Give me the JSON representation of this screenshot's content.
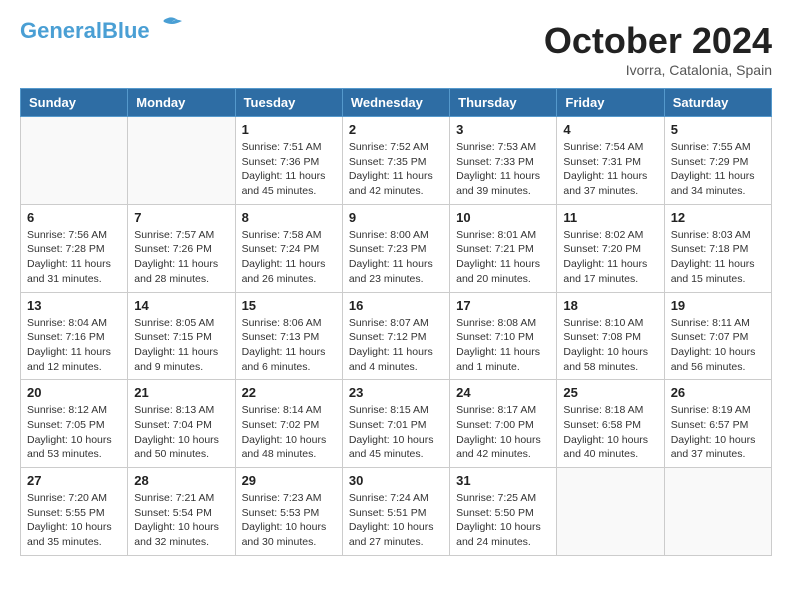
{
  "header": {
    "logo_line1": "General",
    "logo_line2": "Blue",
    "month": "October 2024",
    "location": "Ivorra, Catalonia, Spain"
  },
  "weekdays": [
    "Sunday",
    "Monday",
    "Tuesday",
    "Wednesday",
    "Thursday",
    "Friday",
    "Saturday"
  ],
  "weeks": [
    [
      {
        "day": "",
        "sunrise": "",
        "sunset": "",
        "daylight": ""
      },
      {
        "day": "",
        "sunrise": "",
        "sunset": "",
        "daylight": ""
      },
      {
        "day": "1",
        "sunrise": "Sunrise: 7:51 AM",
        "sunset": "Sunset: 7:36 PM",
        "daylight": "Daylight: 11 hours and 45 minutes."
      },
      {
        "day": "2",
        "sunrise": "Sunrise: 7:52 AM",
        "sunset": "Sunset: 7:35 PM",
        "daylight": "Daylight: 11 hours and 42 minutes."
      },
      {
        "day": "3",
        "sunrise": "Sunrise: 7:53 AM",
        "sunset": "Sunset: 7:33 PM",
        "daylight": "Daylight: 11 hours and 39 minutes."
      },
      {
        "day": "4",
        "sunrise": "Sunrise: 7:54 AM",
        "sunset": "Sunset: 7:31 PM",
        "daylight": "Daylight: 11 hours and 37 minutes."
      },
      {
        "day": "5",
        "sunrise": "Sunrise: 7:55 AM",
        "sunset": "Sunset: 7:29 PM",
        "daylight": "Daylight: 11 hours and 34 minutes."
      }
    ],
    [
      {
        "day": "6",
        "sunrise": "Sunrise: 7:56 AM",
        "sunset": "Sunset: 7:28 PM",
        "daylight": "Daylight: 11 hours and 31 minutes."
      },
      {
        "day": "7",
        "sunrise": "Sunrise: 7:57 AM",
        "sunset": "Sunset: 7:26 PM",
        "daylight": "Daylight: 11 hours and 28 minutes."
      },
      {
        "day": "8",
        "sunrise": "Sunrise: 7:58 AM",
        "sunset": "Sunset: 7:24 PM",
        "daylight": "Daylight: 11 hours and 26 minutes."
      },
      {
        "day": "9",
        "sunrise": "Sunrise: 8:00 AM",
        "sunset": "Sunset: 7:23 PM",
        "daylight": "Daylight: 11 hours and 23 minutes."
      },
      {
        "day": "10",
        "sunrise": "Sunrise: 8:01 AM",
        "sunset": "Sunset: 7:21 PM",
        "daylight": "Daylight: 11 hours and 20 minutes."
      },
      {
        "day": "11",
        "sunrise": "Sunrise: 8:02 AM",
        "sunset": "Sunset: 7:20 PM",
        "daylight": "Daylight: 11 hours and 17 minutes."
      },
      {
        "day": "12",
        "sunrise": "Sunrise: 8:03 AM",
        "sunset": "Sunset: 7:18 PM",
        "daylight": "Daylight: 11 hours and 15 minutes."
      }
    ],
    [
      {
        "day": "13",
        "sunrise": "Sunrise: 8:04 AM",
        "sunset": "Sunset: 7:16 PM",
        "daylight": "Daylight: 11 hours and 12 minutes."
      },
      {
        "day": "14",
        "sunrise": "Sunrise: 8:05 AM",
        "sunset": "Sunset: 7:15 PM",
        "daylight": "Daylight: 11 hours and 9 minutes."
      },
      {
        "day": "15",
        "sunrise": "Sunrise: 8:06 AM",
        "sunset": "Sunset: 7:13 PM",
        "daylight": "Daylight: 11 hours and 6 minutes."
      },
      {
        "day": "16",
        "sunrise": "Sunrise: 8:07 AM",
        "sunset": "Sunset: 7:12 PM",
        "daylight": "Daylight: 11 hours and 4 minutes."
      },
      {
        "day": "17",
        "sunrise": "Sunrise: 8:08 AM",
        "sunset": "Sunset: 7:10 PM",
        "daylight": "Daylight: 11 hours and 1 minute."
      },
      {
        "day": "18",
        "sunrise": "Sunrise: 8:10 AM",
        "sunset": "Sunset: 7:08 PM",
        "daylight": "Daylight: 10 hours and 58 minutes."
      },
      {
        "day": "19",
        "sunrise": "Sunrise: 8:11 AM",
        "sunset": "Sunset: 7:07 PM",
        "daylight": "Daylight: 10 hours and 56 minutes."
      }
    ],
    [
      {
        "day": "20",
        "sunrise": "Sunrise: 8:12 AM",
        "sunset": "Sunset: 7:05 PM",
        "daylight": "Daylight: 10 hours and 53 minutes."
      },
      {
        "day": "21",
        "sunrise": "Sunrise: 8:13 AM",
        "sunset": "Sunset: 7:04 PM",
        "daylight": "Daylight: 10 hours and 50 minutes."
      },
      {
        "day": "22",
        "sunrise": "Sunrise: 8:14 AM",
        "sunset": "Sunset: 7:02 PM",
        "daylight": "Daylight: 10 hours and 48 minutes."
      },
      {
        "day": "23",
        "sunrise": "Sunrise: 8:15 AM",
        "sunset": "Sunset: 7:01 PM",
        "daylight": "Daylight: 10 hours and 45 minutes."
      },
      {
        "day": "24",
        "sunrise": "Sunrise: 8:17 AM",
        "sunset": "Sunset: 7:00 PM",
        "daylight": "Daylight: 10 hours and 42 minutes."
      },
      {
        "day": "25",
        "sunrise": "Sunrise: 8:18 AM",
        "sunset": "Sunset: 6:58 PM",
        "daylight": "Daylight: 10 hours and 40 minutes."
      },
      {
        "day": "26",
        "sunrise": "Sunrise: 8:19 AM",
        "sunset": "Sunset: 6:57 PM",
        "daylight": "Daylight: 10 hours and 37 minutes."
      }
    ],
    [
      {
        "day": "27",
        "sunrise": "Sunrise: 7:20 AM",
        "sunset": "Sunset: 5:55 PM",
        "daylight": "Daylight: 10 hours and 35 minutes."
      },
      {
        "day": "28",
        "sunrise": "Sunrise: 7:21 AM",
        "sunset": "Sunset: 5:54 PM",
        "daylight": "Daylight: 10 hours and 32 minutes."
      },
      {
        "day": "29",
        "sunrise": "Sunrise: 7:23 AM",
        "sunset": "Sunset: 5:53 PM",
        "daylight": "Daylight: 10 hours and 30 minutes."
      },
      {
        "day": "30",
        "sunrise": "Sunrise: 7:24 AM",
        "sunset": "Sunset: 5:51 PM",
        "daylight": "Daylight: 10 hours and 27 minutes."
      },
      {
        "day": "31",
        "sunrise": "Sunrise: 7:25 AM",
        "sunset": "Sunset: 5:50 PM",
        "daylight": "Daylight: 10 hours and 24 minutes."
      },
      {
        "day": "",
        "sunrise": "",
        "sunset": "",
        "daylight": ""
      },
      {
        "day": "",
        "sunrise": "",
        "sunset": "",
        "daylight": ""
      }
    ]
  ]
}
